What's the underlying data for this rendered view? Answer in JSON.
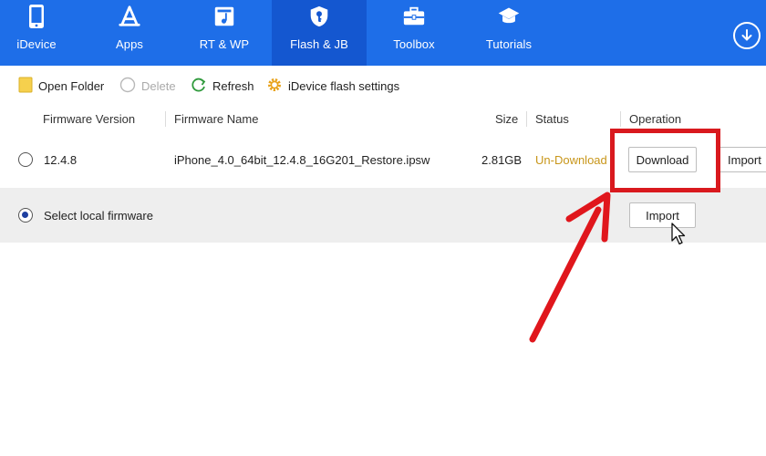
{
  "nav": {
    "items": [
      {
        "label": "iDevice",
        "icon": "phone-icon"
      },
      {
        "label": "Apps",
        "icon": "app-store-icon"
      },
      {
        "label": "RT & WP",
        "icon": "music-note-icon"
      },
      {
        "label": "Flash & JB",
        "icon": "key-shield-icon"
      },
      {
        "label": "Toolbox",
        "icon": "toolbox-icon"
      },
      {
        "label": "Tutorials",
        "icon": "graduation-cap-icon"
      }
    ],
    "active": "Flash & JB",
    "download_icon": "download-circle-icon"
  },
  "toolbar": {
    "open_folder": "Open Folder",
    "delete": "Delete",
    "refresh": "Refresh",
    "flash_settings": "iDevice flash settings"
  },
  "table": {
    "columns": [
      "Firmware Version",
      "Firmware Name",
      "Size",
      "Status",
      "Operation"
    ],
    "rows": [
      {
        "version": "12.4.8",
        "name": "iPhone_4.0_64bit_12.4.8_16G201_Restore.ipsw",
        "size": "2.81GB",
        "status": "Un-Download",
        "download_label": "Download",
        "import_label": "Import"
      }
    ],
    "local": {
      "label": "Select local firmware",
      "import_label": "Import"
    }
  },
  "colors": {
    "nav_bg": "#1e6ee8",
    "status_color": "#c8961a",
    "highlight": "#d9191e"
  }
}
